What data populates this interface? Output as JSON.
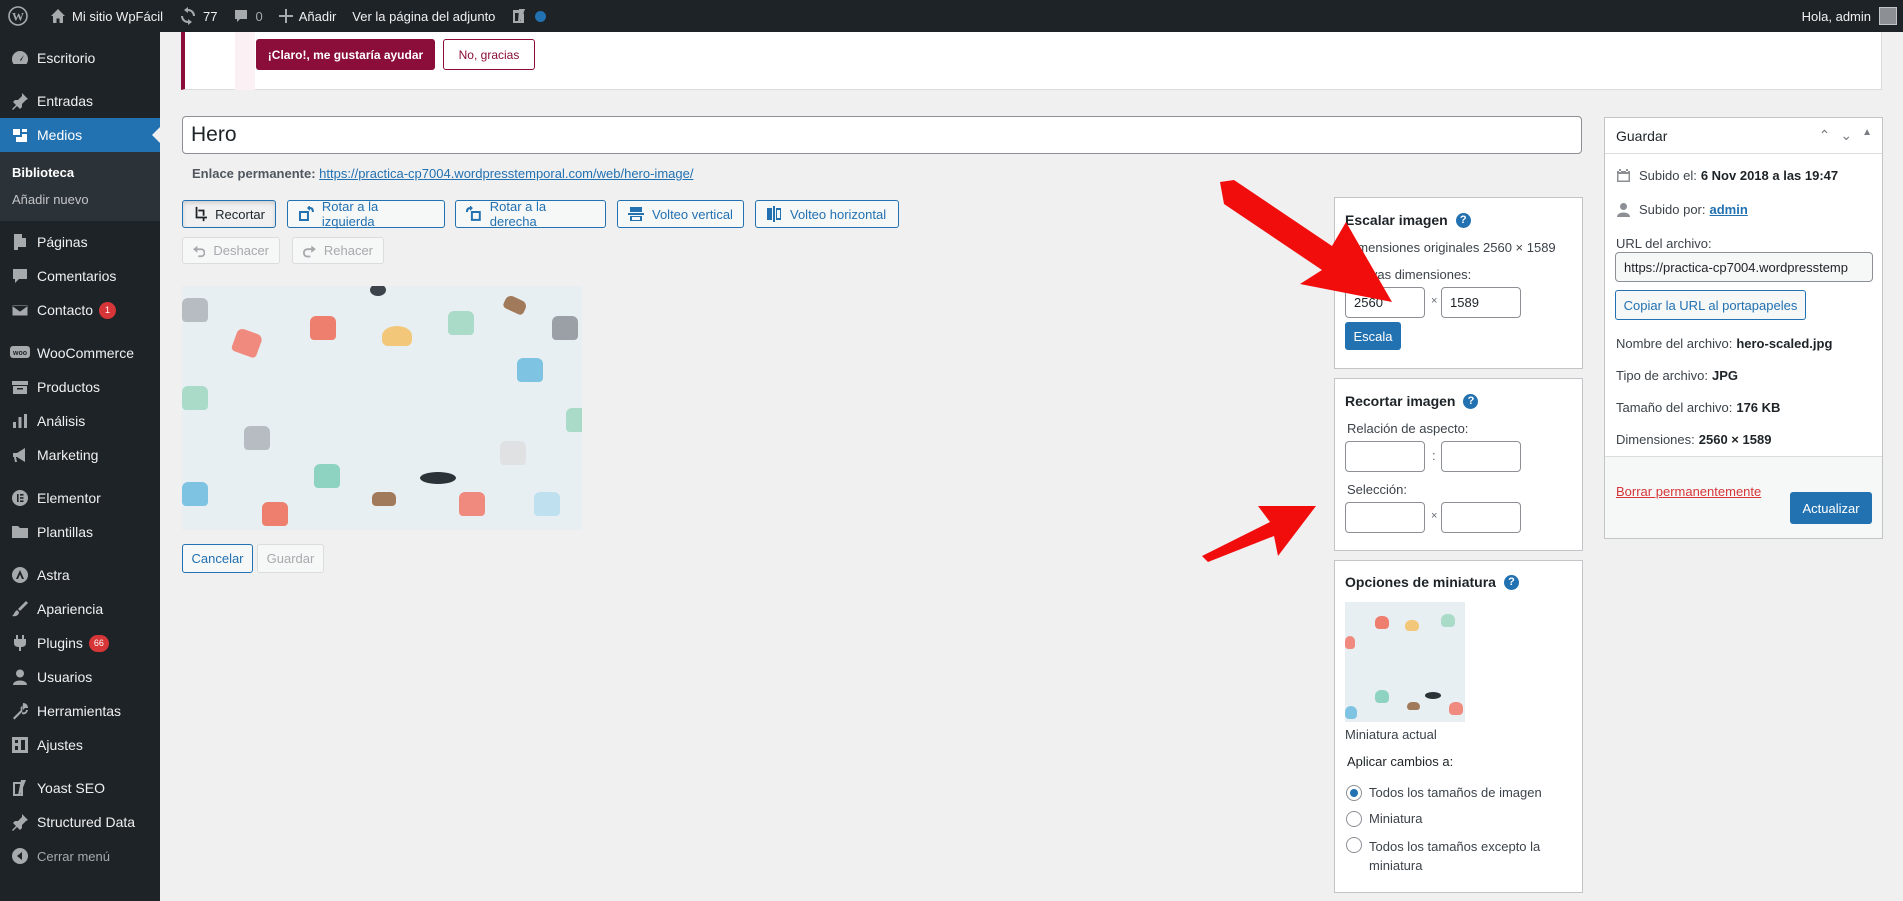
{
  "adminbar": {
    "site_name": "Mi sitio WpFácil",
    "updates_count": "77",
    "comments_count": "0",
    "new_label": "Añadir",
    "view_label": "Ver la página del adjunto",
    "greeting": "Hola, admin"
  },
  "sidebar": {
    "items": [
      {
        "label": "Escritorio",
        "icon": "dashboard-icon"
      },
      {
        "label": "Entradas",
        "icon": "pin-icon"
      },
      {
        "label": "Medios",
        "icon": "media-icon"
      },
      {
        "label": "Páginas",
        "icon": "pages-icon"
      },
      {
        "label": "Comentarios",
        "icon": "comments-icon"
      },
      {
        "label": "Contacto",
        "icon": "mail-icon",
        "badge": "1"
      },
      {
        "label": "WooCommerce",
        "icon": "woo-icon"
      },
      {
        "label": "Productos",
        "icon": "archive-icon"
      },
      {
        "label": "Análisis",
        "icon": "chart-icon"
      },
      {
        "label": "Marketing",
        "icon": "megaphone-icon"
      },
      {
        "label": "Elementor",
        "icon": "elementor-icon"
      },
      {
        "label": "Plantillas",
        "icon": "folder-icon"
      },
      {
        "label": "Astra",
        "icon": "astra-icon"
      },
      {
        "label": "Apariencia",
        "icon": "brush-icon"
      },
      {
        "label": "Plugins",
        "icon": "plugin-icon",
        "badge": "66"
      },
      {
        "label": "Usuarios",
        "icon": "user-icon"
      },
      {
        "label": "Herramientas",
        "icon": "wrench-icon"
      },
      {
        "label": "Ajustes",
        "icon": "settings-icon"
      },
      {
        "label": "Yoast SEO",
        "icon": "yoast-icon"
      },
      {
        "label": "Structured Data",
        "icon": "pin-icon"
      },
      {
        "label": "Cerrar menú",
        "icon": "collapse-icon"
      }
    ],
    "submenu": {
      "library": "Biblioteca",
      "add_new": "Añadir nuevo"
    }
  },
  "notice": {
    "yes_label": "¡Claro!, me gustaría ayudar",
    "no_label": "No, gracias"
  },
  "editor": {
    "title": "Hero",
    "permalink_label": "Enlace permanente:",
    "permalink_url": "https://practica-cp7004.wordpresstemporal.com/web/hero-image/",
    "toolbar": {
      "crop": "Recortar",
      "rotate_left": "Rotar a la izquierda",
      "rotate_right": "Rotar a la derecha",
      "flip_vertical": "Volteo vertical",
      "flip_horizontal": "Volteo horizontal",
      "undo": "Deshacer",
      "redo": "Rehacer"
    },
    "cancel": "Cancelar",
    "save": "Guardar"
  },
  "scale": {
    "title": "Escalar imagen",
    "original": "Dimensiones originales 2560 × 1589",
    "new_dims_label": "Nuevas dimensiones:",
    "width": "2560",
    "height": "1589",
    "times": "×",
    "button": "Escala"
  },
  "crop": {
    "title": "Recortar imagen",
    "aspect_label": "Relación de aspecto:",
    "colon": ":",
    "selection_label": "Selección:",
    "times": "×"
  },
  "thumbnail": {
    "title": "Opciones de miniatura",
    "current_label": "Miniatura actual",
    "apply_label": "Aplicar cambios a:",
    "options": [
      "Todos los tamaños de imagen",
      "Miniatura",
      "Todos los tamaños excepto la miniatura"
    ],
    "selected_index": 0
  },
  "savebox": {
    "title": "Guardar",
    "uploaded_label": "Subido el:",
    "uploaded_value": "6 Nov 2018 a las 19:47",
    "uploaded_by_label": "Subido por:",
    "uploaded_by_value": "admin",
    "file_url_label": "URL del archivo:",
    "file_url_value": "https://practica-cp7004.wordpresstemp",
    "copy_button": "Copiar la URL al portapapeles",
    "filename_label": "Nombre del archivo:",
    "filename_value": "hero-scaled.jpg",
    "filetype_label": "Tipo de archivo:",
    "filetype_value": "JPG",
    "filesize_label": "Tamaño del archivo:",
    "filesize_value": "176 KB",
    "dims_label": "Dimensiones:",
    "dims_value": "2560 × 1589",
    "delete_link": "Borrar permanentemente",
    "update_button": "Actualizar"
  },
  "colors": {
    "accent": "#2271b1",
    "admin_dark": "#1d2327",
    "notice_brand": "#8a0d3a",
    "annotation_arrow": "#f20d0d"
  }
}
